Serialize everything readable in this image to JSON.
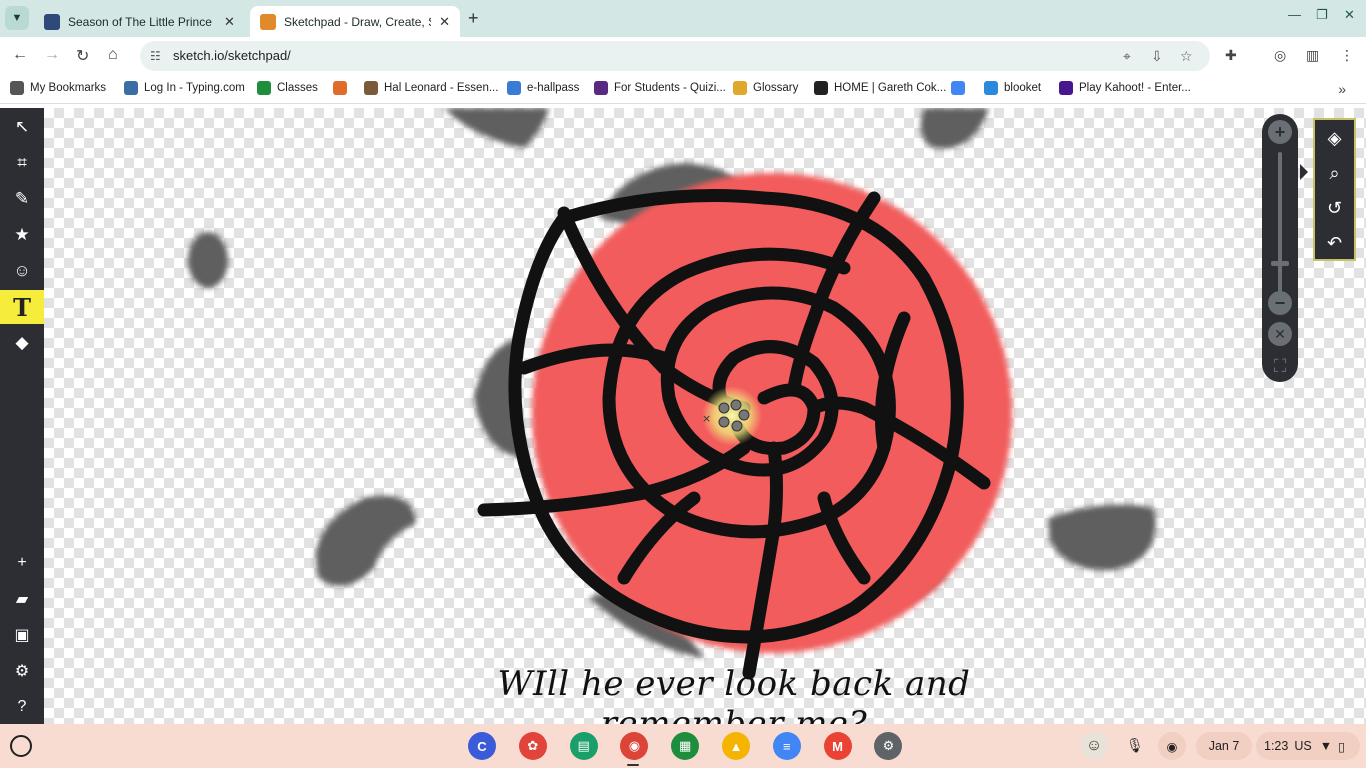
{
  "browser": {
    "tabs": [
      {
        "title": "Season of The Little Prince | Sk",
        "active": false,
        "favicon_color": "#2f4a7a"
      },
      {
        "title": "Sketchpad - Draw, Create, Share",
        "active": true,
        "favicon_color": "#e08a2b"
      }
    ],
    "url": "sketch.io/sketchpad/",
    "bookmarks": [
      {
        "label": "My Bookmarks",
        "icon": "folder-icon",
        "color": "#555555"
      },
      {
        "label": "Log In - Typing.com",
        "icon": "typing-icon",
        "color": "#3a6ea5"
      },
      {
        "label": "Classes",
        "icon": "classes-icon",
        "color": "#1e8e3e"
      },
      {
        "label": "",
        "icon": "p-icon",
        "color": "#e06b2b"
      },
      {
        "label": "Hal Leonard - Essen...",
        "icon": "hal-leonard-icon",
        "color": "#7a5a3a"
      },
      {
        "label": "e-hallpass",
        "icon": "hallpass-icon",
        "color": "#3a7bd5"
      },
      {
        "label": "For Students - Quizi...",
        "icon": "quizizz-icon",
        "color": "#5a2a82"
      },
      {
        "label": "Glossary",
        "icon": "glossary-icon",
        "color": "#e0a82b"
      },
      {
        "label": "HOME | Gareth Cok...",
        "icon": "gareth-icon",
        "color": "#222222"
      },
      {
        "label": "",
        "icon": "google-icon",
        "color": "#4285f4"
      },
      {
        "label": "blooket",
        "icon": "blooket-icon",
        "color": "#2b8ad9"
      },
      {
        "label": "Play Kahoot! - Enter...",
        "icon": "kahoot-icon",
        "color": "#46178f"
      }
    ]
  },
  "left_tools": [
    {
      "name": "select-tool",
      "icon": "↖"
    },
    {
      "name": "crop-tool",
      "icon": "⌗"
    },
    {
      "name": "pen-tool",
      "icon": "✎"
    },
    {
      "name": "stamp-tool",
      "icon": "★"
    },
    {
      "name": "emoji-tool",
      "icon": "☺"
    },
    {
      "name": "text-tool",
      "icon": "T",
      "active": true
    },
    {
      "name": "fill-tool",
      "icon": "◆"
    }
  ],
  "left_tools_bottom": [
    {
      "name": "new-button",
      "icon": "+"
    },
    {
      "name": "open-button",
      "icon": "▰"
    },
    {
      "name": "save-button",
      "icon": "▣"
    },
    {
      "name": "settings-button",
      "icon": "⚙"
    },
    {
      "name": "help-button",
      "icon": "?"
    }
  ],
  "canvas": {
    "caption": "WIll he ever look back and remember me?",
    "rose_color": "#f25c5c",
    "leaf_color": "#5f5f5f"
  },
  "zoom": {
    "level": 0.2
  },
  "right_panel": [
    {
      "name": "layers-button",
      "icon": "◈"
    },
    {
      "name": "search-button",
      "icon": "⌕"
    },
    {
      "name": "history-button",
      "icon": "↺"
    },
    {
      "name": "undo-button",
      "icon": "↶"
    }
  ],
  "shelf": {
    "apps": [
      {
        "name": "canvas-app",
        "color": "#3b5bd9",
        "glyph": "C"
      },
      {
        "name": "paint-app",
        "color": "#e0443a",
        "glyph": "✿"
      },
      {
        "name": "classroom-app",
        "color": "#1a9e6a",
        "glyph": "▤"
      },
      {
        "name": "chrome-app",
        "color": "#db4437",
        "glyph": "◉"
      },
      {
        "name": "google-classroom-app",
        "color": "#1e8e3e",
        "glyph": "▦"
      },
      {
        "name": "drive-app",
        "color": "#f4b400",
        "glyph": "▲"
      },
      {
        "name": "docs-app",
        "color": "#4285f4",
        "glyph": "≡"
      },
      {
        "name": "gmail-app",
        "color": "#ea4335",
        "glyph": "M"
      },
      {
        "name": "settings-app",
        "color": "#5f6368",
        "glyph": "⚙"
      }
    ],
    "date": "Jan 7",
    "time": "1:23",
    "locale": "US"
  }
}
